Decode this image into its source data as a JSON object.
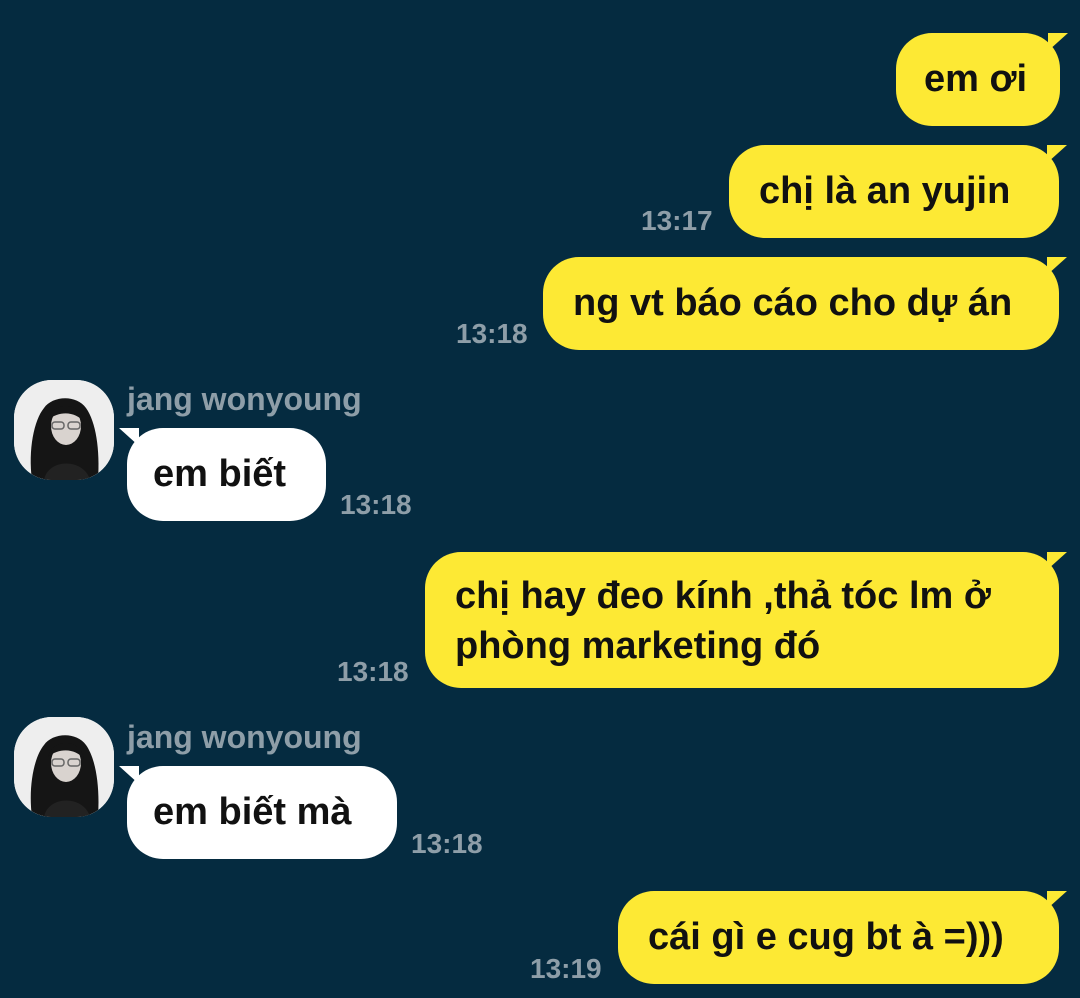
{
  "messages": [
    {
      "side": "out",
      "text": "em ơi",
      "time": ""
    },
    {
      "side": "out",
      "text": "chị là an yujin",
      "time": "13:17"
    },
    {
      "side": "out",
      "text": "ng vt báo cáo cho dự án",
      "time": "13:18"
    },
    {
      "side": "in",
      "sender": "jang wonyoung",
      "text": "em biết",
      "time": "13:18"
    },
    {
      "side": "out",
      "text_line1": "chị hay đeo kính ,thả tóc lm ở",
      "text_line2": "phòng marketing đó",
      "time": "13:18"
    },
    {
      "side": "in",
      "sender": "jang wonyoung",
      "text": "em biết mà",
      "time": "13:18"
    },
    {
      "side": "out",
      "text": "cái gì e cug bt à =)))",
      "time": "13:19"
    }
  ],
  "colors": {
    "background": "#052b40",
    "outgoing_bubble": "#fde934",
    "incoming_bubble": "#ffffff",
    "timestamp": "#8e9ea8"
  }
}
